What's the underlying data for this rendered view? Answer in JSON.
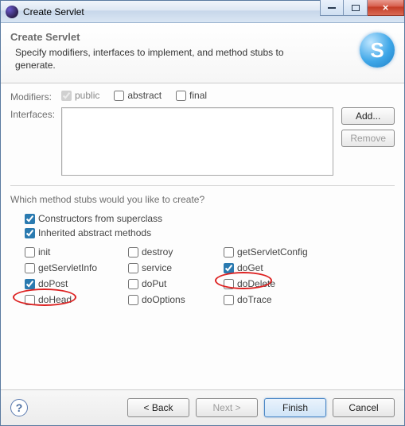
{
  "window": {
    "title": "Create Servlet"
  },
  "banner": {
    "heading": "Create Servlet",
    "description": "Specify modifiers, interfaces to implement, and method stubs to generate.",
    "icon_letter": "S"
  },
  "modifiers": {
    "label": "Modifiers:",
    "items": [
      {
        "label": "public",
        "checked": true,
        "disabled": true
      },
      {
        "label": "abstract",
        "checked": false,
        "disabled": false
      },
      {
        "label": "final",
        "checked": false,
        "disabled": false
      }
    ]
  },
  "interfaces": {
    "label": "Interfaces:",
    "add_label": "Add...",
    "remove_label": "Remove"
  },
  "stubs": {
    "question": "Which method stubs would you like to create?",
    "top": [
      {
        "label": "Constructors from superclass",
        "checked": true
      },
      {
        "label": "Inherited abstract methods",
        "checked": true
      }
    ],
    "grid": [
      {
        "label": "init",
        "checked": false
      },
      {
        "label": "destroy",
        "checked": false
      },
      {
        "label": "getServletConfig",
        "checked": false
      },
      {
        "label": "getServletInfo",
        "checked": false
      },
      {
        "label": "service",
        "checked": false
      },
      {
        "label": "doGet",
        "checked": true
      },
      {
        "label": "doPost",
        "checked": true
      },
      {
        "label": "doPut",
        "checked": false
      },
      {
        "label": "doDelete",
        "checked": false
      },
      {
        "label": "doHead",
        "checked": false
      },
      {
        "label": "doOptions",
        "checked": false
      },
      {
        "label": "doTrace",
        "checked": false
      }
    ]
  },
  "footer": {
    "back": "< Back",
    "next": "Next >",
    "finish": "Finish",
    "cancel": "Cancel"
  }
}
